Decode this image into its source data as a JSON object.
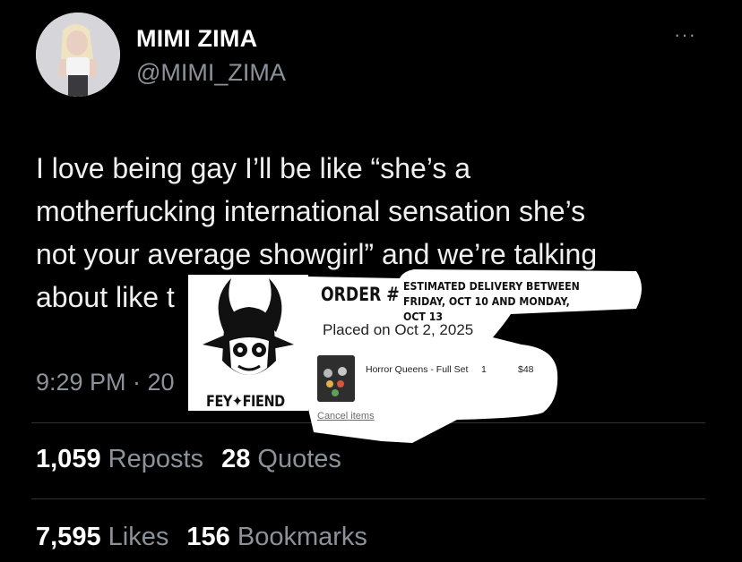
{
  "tweet": {
    "display_name": "MIMI ZIMA",
    "handle": "@MIMI_ZIMA",
    "more_menu": "···",
    "text": "I love being gay I’ll be like “she’s a\nmotherfucking international sensation she’s\nnot your average showgirl” and we’re talking\nabout like t",
    "timestamp": "9:29 PM · 20"
  },
  "stats": {
    "reposts_count": "1,059",
    "reposts_label": "Reposts",
    "quotes_count": "28",
    "quotes_label": "Quotes",
    "likes_count": "7,595",
    "likes_label": "Likes",
    "bookmarks_count": "156",
    "bookmarks_label": "Bookmarks"
  },
  "order": {
    "brand": "FEY✦FIEND",
    "title": "ORDER #",
    "delivery_line1": "ESTIMATED DELIVERY BETWEEN",
    "delivery_line2": "FRIDAY, OCT 10 AND MONDAY, OCT 13",
    "placed_on": "Placed on Oct 2, 2025",
    "item_name": "Horror Queens - Full Set",
    "item_qty": "1",
    "item_price": "$48",
    "cancel_label": "Cancel items"
  },
  "colors": {
    "background": "#000000",
    "primary_text": "#e7e9ea",
    "secondary_text": "#8b9299",
    "divider": "#2f3336"
  }
}
